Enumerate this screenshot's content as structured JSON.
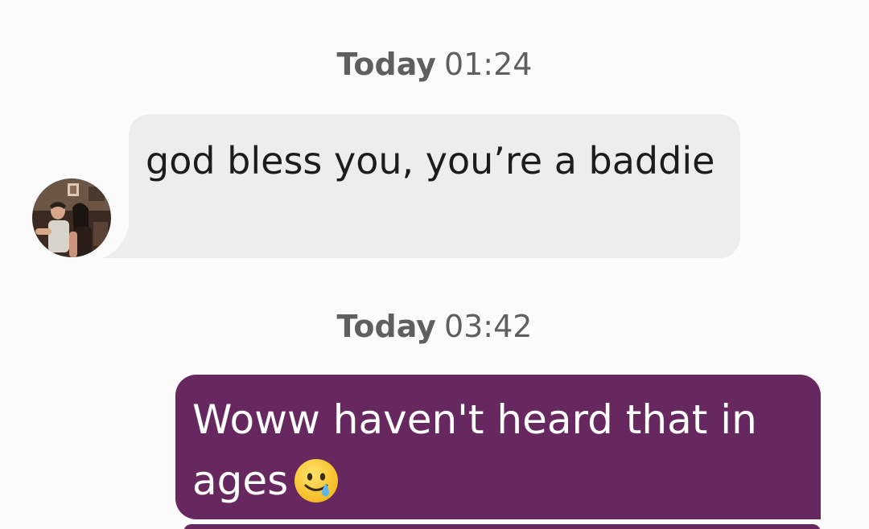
{
  "conversation": {
    "messages": [
      {
        "timestamp_day": "Today",
        "timestamp_time": "01:24",
        "direction": "incoming",
        "text": "god bless you, you’re a baddie",
        "avatar": "contact-avatar-photo"
      },
      {
        "timestamp_day": "Today",
        "timestamp_time": "03:42",
        "direction": "outgoing",
        "text": "Woww haven't heard that in ages",
        "emoji": "smiling-face-with-tear-icon"
      }
    ]
  },
  "colors": {
    "background": "#fbfbfb",
    "incoming_bubble": "#ededee",
    "outgoing_bubble": "#66285f",
    "timestamp_text": "#5f5f5f"
  }
}
